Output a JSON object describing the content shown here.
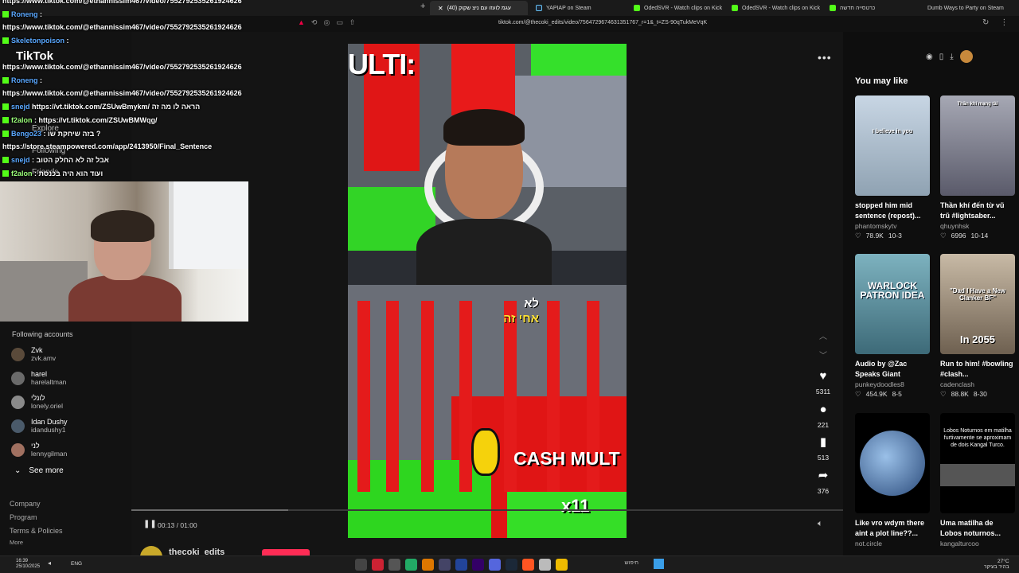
{
  "browser": {
    "tabs": [
      {
        "label": "(40) עגמ לועזו עם ניצ שקוק",
        "active": true
      },
      {
        "label": "YAPIAP on Steam",
        "icon": "steam"
      },
      {
        "label": "OdedSVR - Watch clips on Kick",
        "icon": "kick"
      },
      {
        "label": "OdedSVR - Watch clips on Kick",
        "icon": "kick"
      },
      {
        "label": "כרטסייה חדשה",
        "icon": "blank"
      },
      {
        "label": "Dumb Ways to Party on Steam",
        "icon": "steam"
      }
    ],
    "url": "tiktok.com/@thecoki_edits/video/7564729674631351767_r=1&_t=ZS-90qTukMeVqK"
  },
  "chat": {
    "lines": [
      {
        "text": "https://www.tiktok.com/@ethannissim467/video/7552792535261924626"
      },
      {
        "user": "Roneng",
        "text": ":"
      },
      {
        "text": "https://www.tiktok.com/@ethannissim467/video/7552792535261924626"
      },
      {
        "user": "Skeletonpoison",
        "text": ":"
      },
      {
        "text": "https://www.tiktok.com/@ethannissim467/video/7552792535261924626"
      },
      {
        "user": "Roneng",
        "text": ":"
      },
      {
        "text": "https://www.tiktok.com/@ethannissim467/video/7552792535261924626"
      },
      {
        "user": "snejd",
        "text": "https://vt.tiktok.com/ZSUwBmykm/ הראה לו מה זה"
      },
      {
        "user": "f2alon",
        "text": ": https://vt.tiktok.com/ZSUwBMWqg/"
      },
      {
        "user": "Bengo23",
        "text": ": בזה שיחקת שו ?"
      },
      {
        "text": "https://store.steampowered.com/app/2413950/Final_Sentence"
      },
      {
        "user": "snejd",
        "text": ": אבל זה לא החלק הטוב"
      },
      {
        "user": "f2alon",
        "text": ": ועוד הוא היה בכנסת"
      }
    ]
  },
  "sidebar": {
    "logo": "TikTok",
    "nav": {
      "explore": "Explore",
      "following": "Following",
      "friends": "Friends"
    },
    "following_title": "Following accounts",
    "accounts": [
      {
        "name": "Zvk",
        "handle": "zvk.amv"
      },
      {
        "name": "harel",
        "handle": "harelaltman"
      },
      {
        "name": "לונלי",
        "handle": "lonely.oriel"
      },
      {
        "name": "Idan Dushy",
        "handle": "idandushy1"
      },
      {
        "name": "לני",
        "handle": "lennygilman"
      }
    ],
    "see_more": "See more",
    "footer": [
      "Company",
      "Program",
      "Terms & Policies",
      "More"
    ]
  },
  "video": {
    "top_caption": "ULTI:",
    "hebrew_line1": "לא",
    "hebrew_line2": "אחי זה",
    "bottom_caption": "CASH MULT",
    "multiplier": "x11",
    "time": "00:13 / 01:00",
    "progress": 0.22,
    "author": "thecoki_edits"
  },
  "actions": {
    "likes": "5311",
    "comments": "221",
    "saves": "513",
    "shares": "376"
  },
  "recommended": {
    "title": "You may like",
    "cards": [
      {
        "title": "stopped him mid sentence (repost)...",
        "author": "phantomskytv",
        "likes": "78.9K",
        "date": "10-3",
        "thumb_text": "I believe in you",
        "bg": "#b8c6d4"
      },
      {
        "title": "Thần khí đến từ vũ trũ #lightsaber...",
        "author": "qhuynhsk",
        "likes": "6996",
        "date": "10-14",
        "thumb_text": "Thần khí mạng tài",
        "bg": "#8a8fa0"
      },
      {
        "title": "Audio by @Zac Speaks Giant",
        "author": "punkeydoodles8",
        "likes": "454.9K",
        "date": "8-5",
        "thumb_text": "WARLOCK PATRON IDEA",
        "bg": "#6fa6b4"
      },
      {
        "title": "Run to him! #bowling #clash...",
        "author": "cadenclash",
        "likes": "88.8K",
        "date": "8-30",
        "thumb_text": "\"Dad I Have a New Clanker BF\"",
        "thumb_text2": "In 2055",
        "bg": "#b2a28e"
      },
      {
        "title": "Like vro wdym there aint a plot line??...",
        "author": "not.circle",
        "likes": "",
        "date": "",
        "thumb_text": "",
        "bg": "#2a4a7a"
      },
      {
        "title": "Uma matilha de Lobos noturnos...",
        "author": "kangalturcoo",
        "likes": "",
        "date": "",
        "thumb_text": "Lobos Noturnos em matilha furtivamente se aproximam de dois Kangal Turco.",
        "bg": "#1a1a1a"
      }
    ]
  },
  "taskbar": {
    "time": "16:39",
    "date": "25/10/2025",
    "lang": "ENG",
    "search": "חיפוש",
    "weather_temp": "27°C",
    "weather_desc": "בהיר בעיקר"
  }
}
